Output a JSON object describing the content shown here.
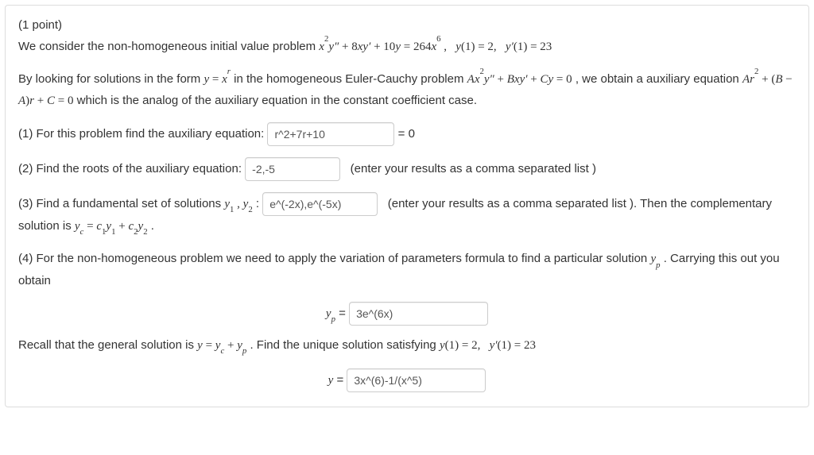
{
  "points": "(1 point)",
  "intro": "We consider the non-homogeneous initial value problem ",
  "explain1": "By looking for solutions in the form ",
  "explain2": " in the homogeneous Euler-Cauchy problem ",
  "explain3": ", we obtain a auxiliary equation ",
  "explain4": " which is the analog of the auxiliary equation in the constant coefficient case.",
  "q1_label": "(1) For this problem find the auxiliary equation: ",
  "q1_value": "r^2+7r+10",
  "eq_zero": " = 0",
  "q2_label": "(2) Find the roots of the auxiliary equation: ",
  "q2_value": "-2,-5",
  "q2_hint": "(enter your results as a comma separated list )",
  "q3_label_a": "(3) Find a fundamental set of solutions ",
  "q3_label_b": ": ",
  "q3_value": "e^(-2x),e^(-5x)",
  "q3_hint": "(enter your results as a comma separated list ). Then the complementary solution is ",
  "q3_eq_end": ".",
  "q4_text": "(4) For the non-homogeneous problem we need to apply the variation of parameters formula to find a particular solution ",
  "q4_text2": ". Carrying this out you obtain",
  "yp_label": " = ",
  "yp_value": "3e^(6x)",
  "recall_a": "Recall that the general solution is ",
  "recall_b": ". Find the unique solution satisfying ",
  "y_label": " = ",
  "y_value": "3x^(6)-1/(x^5)"
}
